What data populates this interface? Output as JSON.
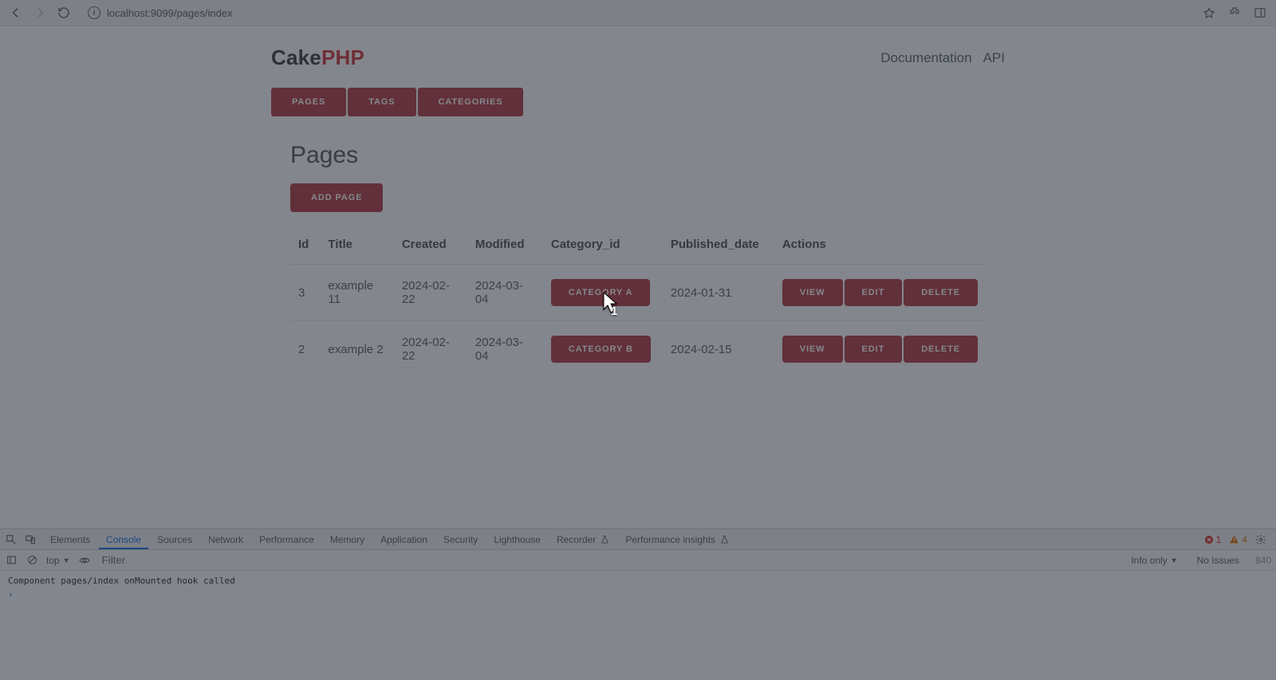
{
  "browser": {
    "url": "localhost:9099/pages/index"
  },
  "brand": {
    "part1": "Cake",
    "part2": "PHP"
  },
  "top_links": {
    "doc": "Documentation",
    "api": "API"
  },
  "nav": {
    "pages": "Pages",
    "tags": "Tags",
    "categories": "Categories"
  },
  "page": {
    "title": "Pages",
    "add_label": "Add Page",
    "columns": {
      "id": "Id",
      "title": "Title",
      "created": "Created",
      "modified": "Modified",
      "category": "Category_id",
      "published": "Published_date",
      "actions": "Actions"
    },
    "actions": {
      "view": "View",
      "edit": "Edit",
      "delete": "Delete"
    },
    "rows": [
      {
        "id": "3",
        "title": "example 11",
        "created": "2024-02-22",
        "modified": "2024-03-04",
        "category": "Category A",
        "published": "2024-01-31"
      },
      {
        "id": "2",
        "title": "example 2",
        "created": "2024-02-22",
        "modified": "2024-03-04",
        "category": "Category B",
        "published": "2024-02-15"
      }
    ]
  },
  "devtools": {
    "tabs": {
      "elements": "Elements",
      "console": "Console",
      "sources": "Sources",
      "network": "Network",
      "performance": "Performance",
      "memory": "Memory",
      "application": "Application",
      "security": "Security",
      "lighthouse": "Lighthouse",
      "recorder": "Recorder",
      "perf_insights": "Performance insights"
    },
    "errors": "1",
    "warnings": "4",
    "context": "top",
    "filter_placeholder": "Filter",
    "levels": "Info only",
    "issues": "No Issues",
    "hidden": "840",
    "log": "Component pages/index onMounted hook called"
  },
  "overlay": {
    "label": "1"
  }
}
